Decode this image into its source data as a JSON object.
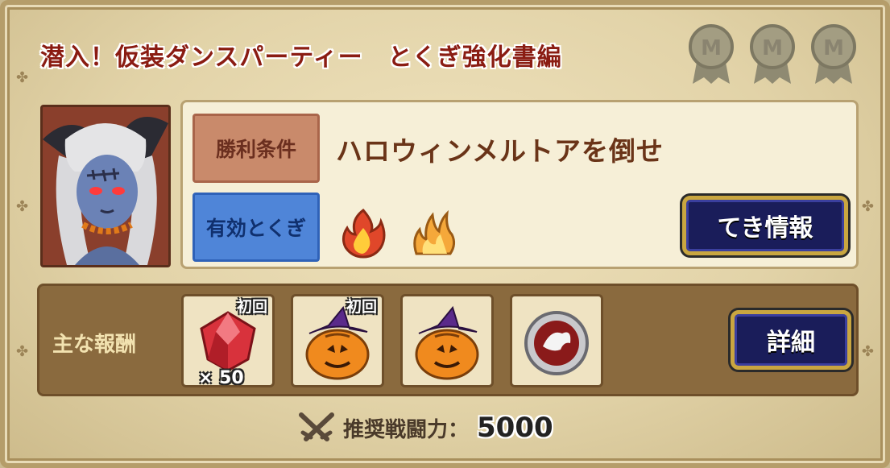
{
  "title": "潜入！仮装ダンスパーティー　とくぎ強化書編",
  "medals": [
    {
      "icon": "medal-icon",
      "earned": false
    },
    {
      "icon": "medal-icon",
      "earned": false
    },
    {
      "icon": "medal-icon",
      "earned": false
    }
  ],
  "boss": {
    "icon": "boss-portrait-icon"
  },
  "conditions": {
    "win_label": "勝利条件",
    "win_text": "ハロウィンメルトアを倒せ",
    "effective_label": "有効とくぎ",
    "effective_icons": [
      "fire-icon",
      "flame-icon"
    ],
    "enemy_info_button": "てき情報"
  },
  "rewards": {
    "label": "主な報酬",
    "items": [
      {
        "icon": "ruby-gem-icon",
        "badge": "初回",
        "quantity": "× 50"
      },
      {
        "icon": "pumpkin-witch-icon",
        "badge": "初回",
        "quantity": ""
      },
      {
        "icon": "pumpkin-witch-icon",
        "badge": "",
        "quantity": ""
      },
      {
        "icon": "silver-coin-icon",
        "badge": "",
        "quantity": ""
      }
    ],
    "detail_button": "詳細"
  },
  "recommended_power": {
    "label": "推奨戦闘力：",
    "value": "5000"
  },
  "colors": {
    "title": "#8a1c12",
    "win_label_bg": "#c98a6b",
    "effective_label_bg": "#4f85d8",
    "button_bg": "#1a1d5a",
    "button_border": "#c9a640"
  }
}
